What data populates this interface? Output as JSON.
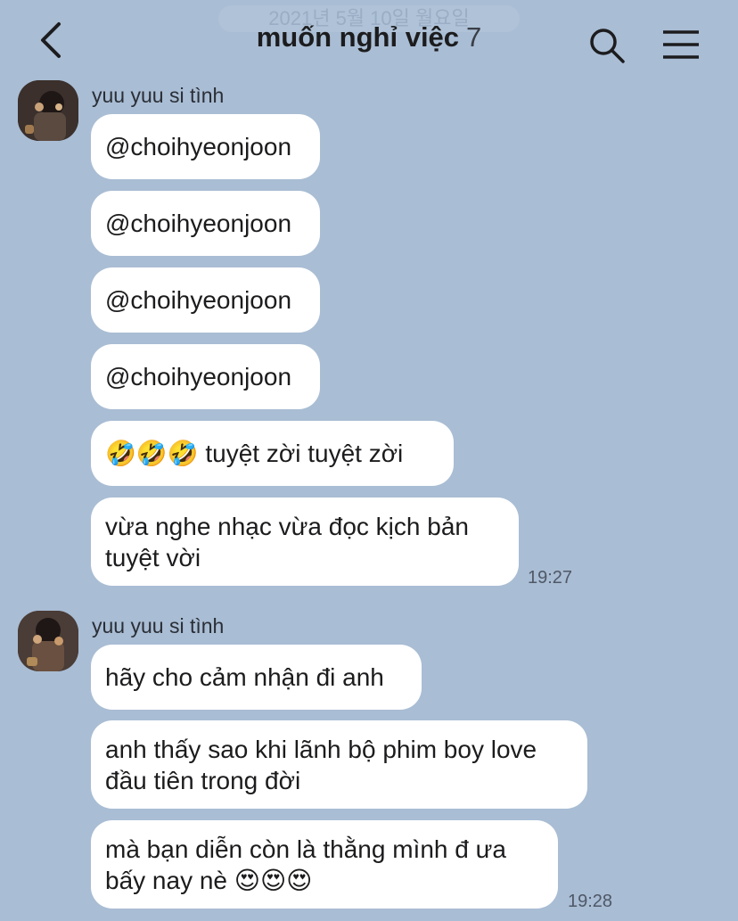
{
  "header": {
    "date_chip": "2021년 5월 10일 월요일",
    "title": "muốn nghỉ việc",
    "member_count": "7"
  },
  "groups": [
    {
      "sender": "yuu yuu si tình",
      "messages": [
        "@choihyeonjoon",
        "@choihyeonjoon",
        "@choihyeonjoon",
        "@choihyeonjoon",
        "🤣🤣🤣 tuyệt zời tuyệt zời",
        "vừa nghe nhạc vừa đọc kịch bản\ntuyệt vời"
      ],
      "time": "19:27"
    },
    {
      "sender": "yuu yuu si tình",
      "messages": [
        "hãy cho cảm nhận đi anh",
        "anh thấy sao khi lãnh bộ phim boy love\nđầu tiên trong đời",
        "mà bạn diễn còn là thằng mình đ ưa\nbấy nay nè 😍😍😍"
      ],
      "time": "19:28"
    }
  ],
  "colors": {
    "background": "#a9bdd4",
    "bubble": "#ffffff",
    "text": "#1c1c1e"
  },
  "icons": [
    "back-arrow-icon",
    "search-icon",
    "menu-icon"
  ]
}
